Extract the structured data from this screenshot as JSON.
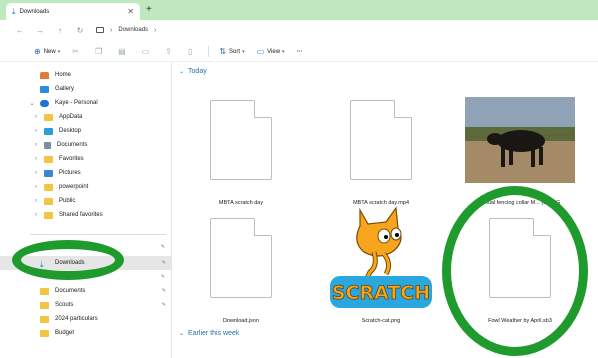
{
  "tab": {
    "title": "Downloads",
    "close": "✕",
    "new": "+"
  },
  "address": {
    "path": [
      "Downloads"
    ]
  },
  "toolbar": {
    "new_label": "New",
    "sort_label": "Sort",
    "view_label": "View",
    "more": "···"
  },
  "sidebar": {
    "items": [
      {
        "label": "Home"
      },
      {
        "label": "Gallery"
      },
      {
        "label": "Kaye - Personal"
      },
      {
        "label": "AppData"
      },
      {
        "label": "Desktop"
      },
      {
        "label": "Documents"
      },
      {
        "label": "Favorites"
      },
      {
        "label": "Pictures"
      },
      {
        "label": "powerpoint"
      },
      {
        "label": "Public"
      },
      {
        "label": "Shared favorites"
      }
    ],
    "quick": [
      {
        "label": "Downloads"
      },
      {
        "label": "Documents"
      },
      {
        "label": "Scouts"
      },
      {
        "label": "2024 particulars"
      },
      {
        "label": "Budget"
      }
    ]
  },
  "groups": {
    "today": "Today",
    "earlier": "Earlier this week"
  },
  "files": [
    {
      "name": "MBTA scratch day"
    },
    {
      "name": "MBTA scratch day.mp4"
    },
    {
      "name": "Virtual fencing collar M... (1).JPG"
    },
    {
      "name": "Download.json"
    },
    {
      "name": "Scratch-cat.png"
    },
    {
      "name": "Fowl Weather by April.sb3"
    }
  ],
  "scratch_logo": "SCRATCH",
  "colors": {
    "accent": "#0a7cd8",
    "tabbar": "#bfe8bf",
    "annotation": "#1f9b2e"
  }
}
